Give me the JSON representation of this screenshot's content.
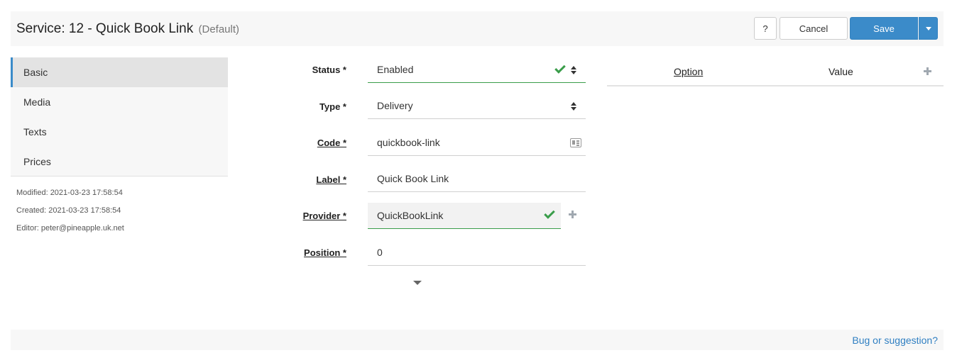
{
  "header": {
    "title": "Service: 12 - Quick Book Link",
    "subtitle": "(Default)",
    "help_label": "?",
    "cancel_label": "Cancel",
    "save_label": "Save"
  },
  "sidebar": {
    "items": [
      {
        "label": "Basic",
        "active": true
      },
      {
        "label": "Media"
      },
      {
        "label": "Texts"
      },
      {
        "label": "Prices"
      }
    ],
    "meta": {
      "modified": "Modified: 2021-03-23 17:58:54",
      "created": "Created: 2021-03-23 17:58:54",
      "editor": "Editor: peter@pineapple.uk.net"
    }
  },
  "form": {
    "status": {
      "label": "Status *",
      "value": "Enabled"
    },
    "type": {
      "label": "Type *",
      "value": "Delivery"
    },
    "code": {
      "label": "Code *",
      "value": "quickbook-link"
    },
    "label": {
      "label": "Label *",
      "value": "Quick Book Link"
    },
    "provider": {
      "label": "Provider *",
      "value": "QuickBookLink"
    },
    "position": {
      "label": "Position *",
      "value": "0"
    }
  },
  "options_table": {
    "columns": [
      "Option",
      "Value"
    ]
  },
  "footer": {
    "link": "Bug or suggestion?"
  },
  "icons": {
    "valid": "check-icon",
    "select": "sort-arrows-icon",
    "code_helper": "id-card-icon",
    "add": "plus-icon",
    "expand": "caret-down-icon"
  },
  "colors": {
    "primary": "#3b8bc9",
    "valid": "#3a9d4a",
    "link": "#2f7fc2"
  }
}
